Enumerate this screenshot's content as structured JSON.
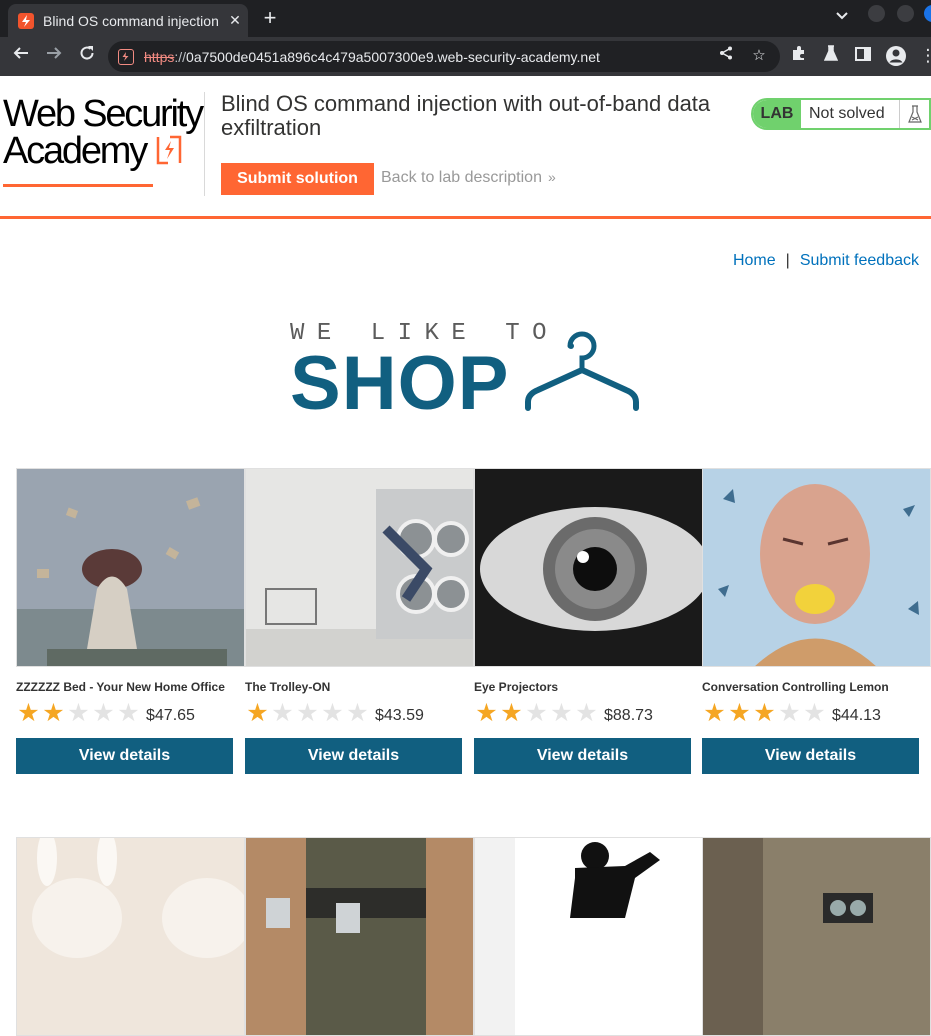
{
  "browser": {
    "tab_title": "Blind OS command injection with out-of-band",
    "url_protocol": "https",
    "url_sep": "://",
    "url_host": "0a7500de0451a896c4c479a5007300e9.web-security-academy.net"
  },
  "lab": {
    "logo_line1": "Web Security",
    "logo_line2": "Academy",
    "title": "Blind OS command injection with out-of-band data exfiltration",
    "submit_label": "Submit solution",
    "back_label": "Back to lab description",
    "badge_label": "LAB",
    "status": "Not solved"
  },
  "nav": {
    "home": "Home",
    "separator": "|",
    "feedback": "Submit feedback"
  },
  "shop_logo": {
    "tagline": "WE LIKE TO",
    "word": "SHOP"
  },
  "products": [
    {
      "name": "ZZZZZZ Bed - Your New Home Office",
      "rating": 2,
      "price": "$47.65",
      "button": "View details"
    },
    {
      "name": "The Trolley-ON",
      "rating": 1,
      "price": "$43.59",
      "button": "View details"
    },
    {
      "name": "Eye Projectors",
      "rating": 2,
      "price": "$88.73",
      "button": "View details"
    },
    {
      "name": "Conversation Controlling Lemon",
      "rating": 3,
      "price": "$44.13",
      "button": "View details"
    }
  ],
  "colors": {
    "accent_orange": "#ff6633",
    "shop_blue": "#115f80",
    "link_blue": "#0071bc",
    "lab_green": "#70d16d",
    "star": "#f5a623"
  }
}
